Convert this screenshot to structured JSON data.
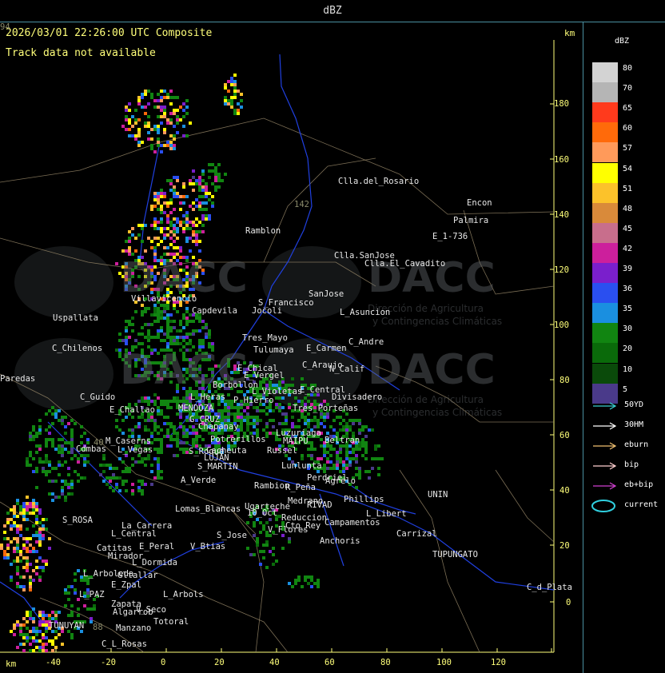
{
  "window": {
    "title": "dBZ"
  },
  "header": {
    "timestamp": "2026/03/01 22:26:00 UTC Composite",
    "track_status": "Track data not available",
    "km_unit_top": "km",
    "km_unit_bottom": "km"
  },
  "axes": {
    "y_ticks": [
      "180",
      "160",
      "140",
      "120",
      "100",
      "80",
      "60",
      "40",
      "20",
      "0"
    ],
    "x_ticks": [
      "-40",
      "-20",
      "0",
      "20",
      "40",
      "60",
      "80",
      "100",
      "120"
    ]
  },
  "watermark": {
    "brand": "DACC",
    "subtitle_line1": "Dirección de Agricultura",
    "subtitle_line2": "y Contingencias Climáticas"
  },
  "places": [
    {
      "name": "Clla.del_Rosario"
    },
    {
      "name": "Encon"
    },
    {
      "name": "E_1-736"
    },
    {
      "name": "Ramblon"
    },
    {
      "name": "Clla.SanJose"
    },
    {
      "name": "Clla.El_Cavadito"
    },
    {
      "name": "S_Francisco"
    },
    {
      "name": "SanJose"
    },
    {
      "name": "Jocoli"
    },
    {
      "name": "L_Asuncion"
    },
    {
      "name": "Villavicencio"
    },
    {
      "name": "Uspallata"
    },
    {
      "name": "Capdevila"
    },
    {
      "name": "Tres_Mayo"
    },
    {
      "name": "C_Andre"
    },
    {
      "name": "E_Carmen"
    },
    {
      "name": "C_Chilenos"
    },
    {
      "name": "Tulumaya"
    },
    {
      "name": "E_Chical"
    },
    {
      "name": "C_Araujo"
    },
    {
      "name": "N_Calif"
    },
    {
      "name": "E_Vergel"
    },
    {
      "name": "Paredas"
    },
    {
      "name": "Borbollon"
    },
    {
      "name": "L_Violetas"
    },
    {
      "name": "E_Central"
    },
    {
      "name": "Divisadero"
    },
    {
      "name": "C_Guido"
    },
    {
      "name": "L_Heras"
    },
    {
      "name": "P_Hierro"
    },
    {
      "name": "E_Challao"
    },
    {
      "name": "MENDOZA"
    },
    {
      "name": "G_CRUZ"
    },
    {
      "name": "Tres_Porteñas"
    },
    {
      "name": "Chapanay"
    },
    {
      "name": "Luzuriaga"
    },
    {
      "name": "Beltran"
    },
    {
      "name": "M_Caserns"
    },
    {
      "name": "Potrerillos"
    },
    {
      "name": "MAIPU"
    },
    {
      "name": "Cdmbas"
    },
    {
      "name": "L_Vegas"
    },
    {
      "name": "Cacheuta"
    },
    {
      "name": "Russel"
    },
    {
      "name": "S_Roque"
    },
    {
      "name": "LUJAN"
    },
    {
      "name": "Lunlunta"
    },
    {
      "name": "S_MARTIN"
    },
    {
      "name": "Perdriel"
    },
    {
      "name": "A_Verde"
    },
    {
      "name": "Agrelo"
    },
    {
      "name": "Rambion"
    },
    {
      "name": "R_Peña"
    },
    {
      "name": "UNIN"
    },
    {
      "name": "Lomas_Blancas"
    },
    {
      "name": "Ugarteche"
    },
    {
      "name": "Medrano"
    },
    {
      "name": "RIVAD"
    },
    {
      "name": "Phillips"
    },
    {
      "name": "10_Oct"
    },
    {
      "name": "Reduccion"
    },
    {
      "name": "L_Libert"
    },
    {
      "name": "S_ROSA"
    },
    {
      "name": "La_Carrera"
    },
    {
      "name": "Cto_Rey"
    },
    {
      "name": "Campamentos"
    },
    {
      "name": "L_Central"
    },
    {
      "name": "S_Jose"
    },
    {
      "name": "Carrizal"
    },
    {
      "name": "Catitas"
    },
    {
      "name": "E_Peral"
    },
    {
      "name": "V_Btias"
    },
    {
      "name": "Anchoris"
    },
    {
      "name": "Mirador"
    },
    {
      "name": "TUPUNGATO"
    },
    {
      "name": "L_Dormida"
    },
    {
      "name": "L_Arboleda"
    },
    {
      "name": "Gltallar"
    },
    {
      "name": "E_Zpal"
    },
    {
      "name": "C_d_Plata"
    },
    {
      "name": "L_PAZ"
    },
    {
      "name": "L_Arbols"
    },
    {
      "name": "Zapata"
    },
    {
      "name": "Algarrob"
    },
    {
      "name": "V_Seco"
    },
    {
      "name": "Totoral"
    },
    {
      "name": "TUNUYAN"
    },
    {
      "name": "Manzano"
    },
    {
      "name": "C_L_Rosas"
    },
    {
      "name": "V_Flores"
    },
    {
      "name": "Palmira"
    },
    {
      "name": "142"
    },
    {
      "name": "40"
    },
    {
      "name": "88"
    },
    {
      "name": "94"
    }
  ],
  "legend": {
    "title": "dBZ",
    "scale": [
      {
        "label": "80",
        "color": "#d3d3d3"
      },
      {
        "label": "70",
        "color": "#b5b5b5"
      },
      {
        "label": "65",
        "color": "#ff3a1c"
      },
      {
        "label": "60",
        "color": "#ff6a0a"
      },
      {
        "label": "57",
        "color": "#ff9a5a"
      },
      {
        "label": "54",
        "color": "#ffff00"
      },
      {
        "label": "51",
        "color": "#fcc22a"
      },
      {
        "label": "48",
        "color": "#d98a3a"
      },
      {
        "label": "45",
        "color": "#c86e8c"
      },
      {
        "label": "42",
        "color": "#cc1f9c"
      },
      {
        "label": "39",
        "color": "#7a1fcc"
      },
      {
        "label": "36",
        "color": "#2a4ff0"
      },
      {
        "label": "35",
        "color": "#1a8fe0"
      },
      {
        "label": "30",
        "color": "#118511"
      },
      {
        "label": "20",
        "color": "#0a6a0a"
      },
      {
        "label": "10",
        "color": "#0a4a0a"
      },
      {
        "label": "5",
        "color": "#4a3a8a"
      }
    ],
    "tracks": [
      {
        "label": "50YD",
        "color": "#3ad0d0"
      },
      {
        "label": "30HM",
        "color": "#ffffff"
      },
      {
        "label": "eburn",
        "color": "#f0c070"
      },
      {
        "label": "bip",
        "color": "#ffd0d0"
      },
      {
        "label": "eb+bip",
        "color": "#d040d0"
      },
      {
        "label": "current",
        "color": "#30d0e0"
      }
    ]
  }
}
